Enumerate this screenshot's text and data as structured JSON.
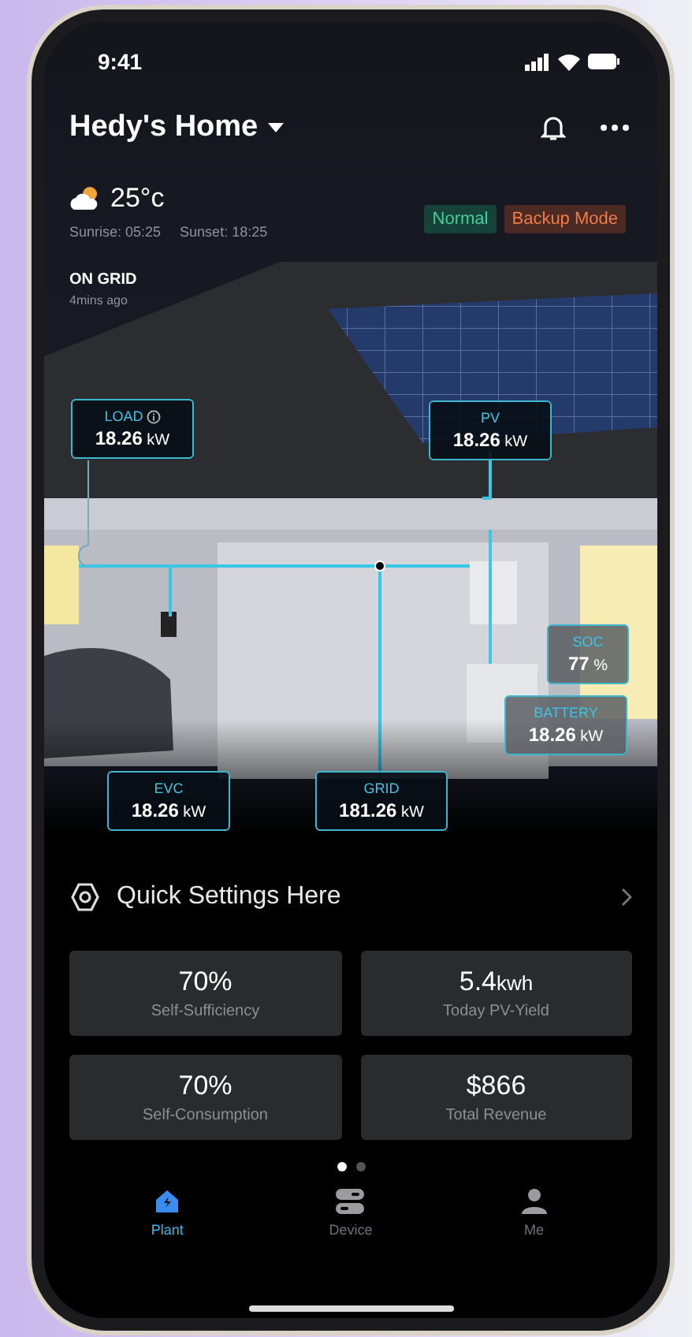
{
  "status_bar": {
    "time": "9:41"
  },
  "header": {
    "title": "Hedy's Home"
  },
  "weather": {
    "temperature": "25°c",
    "sunrise": "Sunrise: 05:25",
    "sunset": "Sunset: 18:25"
  },
  "badges": [
    {
      "label": "Normal",
      "kind": "normal"
    },
    {
      "label": "Backup Mode",
      "kind": "backup"
    }
  ],
  "grid_status": {
    "label": "ON GRID",
    "updated": "4mins ago"
  },
  "flows": [
    {
      "kind": "load",
      "label": "LOAD",
      "value": "18.26",
      "unit": "kW"
    },
    {
      "kind": "pv",
      "label": "PV",
      "value": "18.26",
      "unit": "kW"
    },
    {
      "kind": "soc",
      "label": "SOC",
      "value": "77",
      "unit": "%"
    },
    {
      "kind": "battery",
      "label": "BATTERY",
      "value": "18.26",
      "unit": "kW"
    },
    {
      "kind": "evc",
      "label": "EVC",
      "value": "18.26",
      "unit": "kW"
    },
    {
      "kind": "grid",
      "label": "GRID",
      "value": "181.26",
      "unit": "kW"
    }
  ],
  "quick_settings": {
    "label": "Quick Settings Here"
  },
  "stats": [
    {
      "value": "70%",
      "label": "Self-Sufficiency"
    },
    {
      "value": "5.4",
      "unit": "kwh",
      "label": "Today PV-Yield"
    },
    {
      "value": "70%",
      "label": "Self-Consumption"
    },
    {
      "value": "$866",
      "label": "Total Revenue"
    }
  ],
  "pager": [
    {
      "selected": true
    },
    {
      "selected": false
    }
  ],
  "tabs": [
    {
      "label": "Plant",
      "kind": "plant",
      "selected": true
    },
    {
      "label": "Device",
      "kind": "device",
      "selected": false
    },
    {
      "label": "Me",
      "kind": "me",
      "selected": false
    }
  ]
}
